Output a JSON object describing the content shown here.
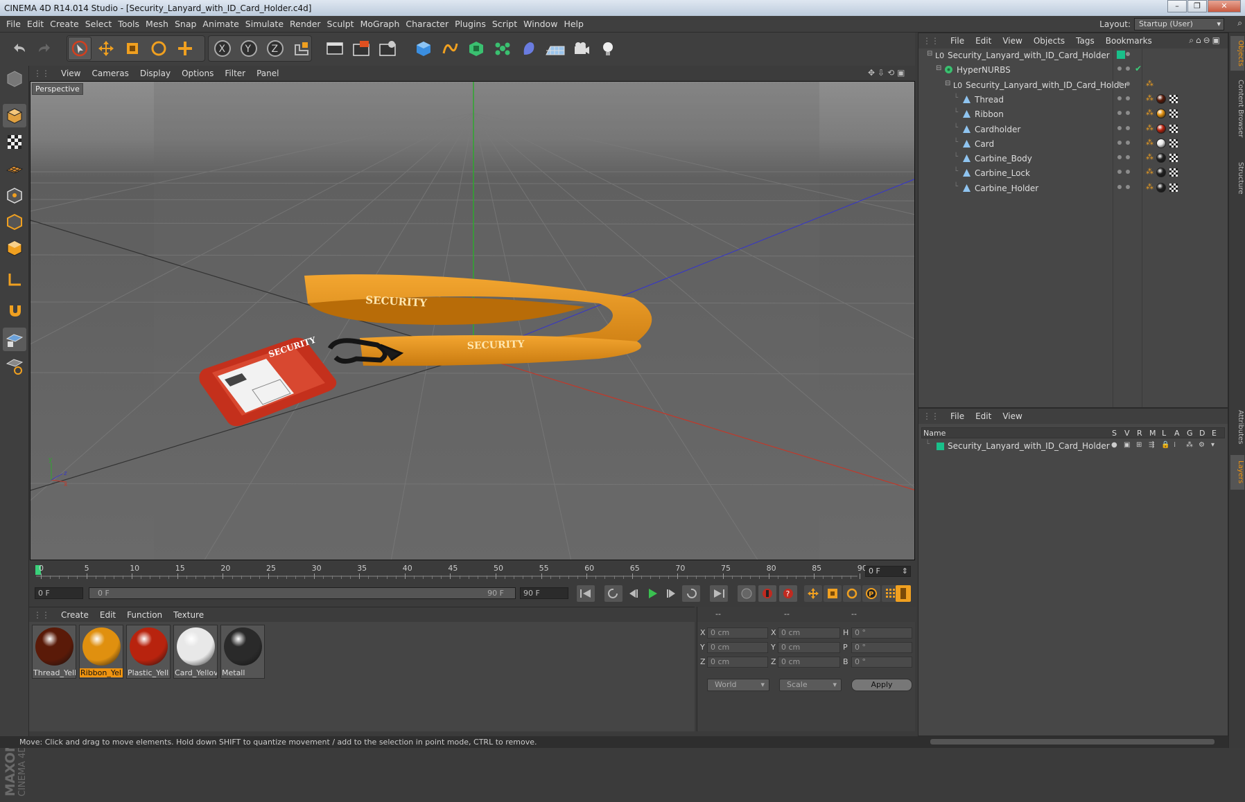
{
  "window": {
    "title": "CINEMA 4D R14.014 Studio - [Security_Lanyard_with_ID_Card_Holder.c4d]"
  },
  "menubar": {
    "items": [
      "File",
      "Edit",
      "Create",
      "Select",
      "Tools",
      "Mesh",
      "Snap",
      "Animate",
      "Simulate",
      "Render",
      "Sculpt",
      "MoGraph",
      "Character",
      "Plugins",
      "Script",
      "Window",
      "Help"
    ],
    "layout_label": "Layout:",
    "layout_value": "Startup (User)"
  },
  "viewport": {
    "menu": [
      "View",
      "Cameras",
      "Display",
      "Options",
      "Filter",
      "Panel"
    ],
    "label": "Perspective",
    "lanyard_text_1": "SECURITY",
    "lanyard_text_2": "SECURITY",
    "card_text": "SECURITY"
  },
  "timeline": {
    "ticks": [
      "0",
      "5",
      "10",
      "15",
      "20",
      "25",
      "30",
      "35",
      "40",
      "45",
      "50",
      "55",
      "60",
      "65",
      "70",
      "75",
      "80",
      "85",
      "90"
    ],
    "current_frame": "0 F"
  },
  "transport": {
    "start_field": "0 F",
    "range_start": "0 F",
    "range_end": "90 F",
    "end_field": "90 F"
  },
  "materials": {
    "menu": [
      "Create",
      "Edit",
      "Function",
      "Texture"
    ],
    "items": [
      {
        "label": "Thread_Yell",
        "color": "#5a1a08"
      },
      {
        "label": "Ribbon_Yel",
        "color": "#e0900f",
        "selected": true
      },
      {
        "label": "Plastic_Yell",
        "color": "#b8230e"
      },
      {
        "label": "Card_Yellov",
        "color": "#e8e8e8"
      },
      {
        "label": "Metall",
        "color": "#2a2a2a"
      }
    ]
  },
  "coordinates": {
    "header": [
      "--",
      "--",
      "--"
    ],
    "rows": [
      {
        "a": "X",
        "v1": "0 cm",
        "b": "X",
        "v2": "0 cm",
        "c": "H",
        "v3": "0 °"
      },
      {
        "a": "Y",
        "v1": "0 cm",
        "b": "Y",
        "v2": "0 cm",
        "c": "P",
        "v3": "0 °"
      },
      {
        "a": "Z",
        "v1": "0 cm",
        "b": "Z",
        "v2": "0 cm",
        "c": "B",
        "v3": "0 °"
      }
    ],
    "world": "World",
    "scale": "Scale",
    "apply": "Apply"
  },
  "status": "Move: Click and drag to move elements. Hold down SHIFT to quantize movement / add to the selection in point mode, CTRL to remove.",
  "objects": {
    "menu": [
      "File",
      "Edit",
      "View",
      "Objects",
      "Tags",
      "Bookmarks"
    ],
    "tree": [
      {
        "name": "Security_Lanyard_with_ID_Card_Holder",
        "level": 0,
        "type": "null"
      },
      {
        "name": "HyperNURBS",
        "level": 1,
        "type": "nurbs"
      },
      {
        "name": "Security_Lanyard_with_ID_Card_Holder",
        "level": 2,
        "type": "null"
      },
      {
        "name": "Thread",
        "level": 3,
        "type": "poly",
        "mat": "#5a1a08"
      },
      {
        "name": "Ribbon",
        "level": 3,
        "type": "poly",
        "mat": "#e0900f"
      },
      {
        "name": "Cardholder",
        "level": 3,
        "type": "poly",
        "mat": "#b8230e"
      },
      {
        "name": "Card",
        "level": 3,
        "type": "poly",
        "mat": "#e8e8e8"
      },
      {
        "name": "Carbine_Body",
        "level": 3,
        "type": "poly",
        "mat": "#222222"
      },
      {
        "name": "Carbine_Lock",
        "level": 3,
        "type": "poly",
        "mat": "#222222"
      },
      {
        "name": "Carbine_Holder",
        "level": 3,
        "type": "poly",
        "mat": "#222222"
      }
    ]
  },
  "layers": {
    "menu": [
      "File",
      "Edit",
      "View"
    ],
    "header_name": "Name",
    "header_cols": [
      "S",
      "V",
      "R",
      "M",
      "L",
      "A",
      "G",
      "D",
      "E"
    ],
    "rows": [
      {
        "name": "Security_Lanyard_with_ID_Card_Holder",
        "color": "#19c08a"
      }
    ]
  },
  "sidetabs": [
    "Objects",
    "Content Browser",
    "Structure",
    "Attributes",
    "Layers"
  ]
}
